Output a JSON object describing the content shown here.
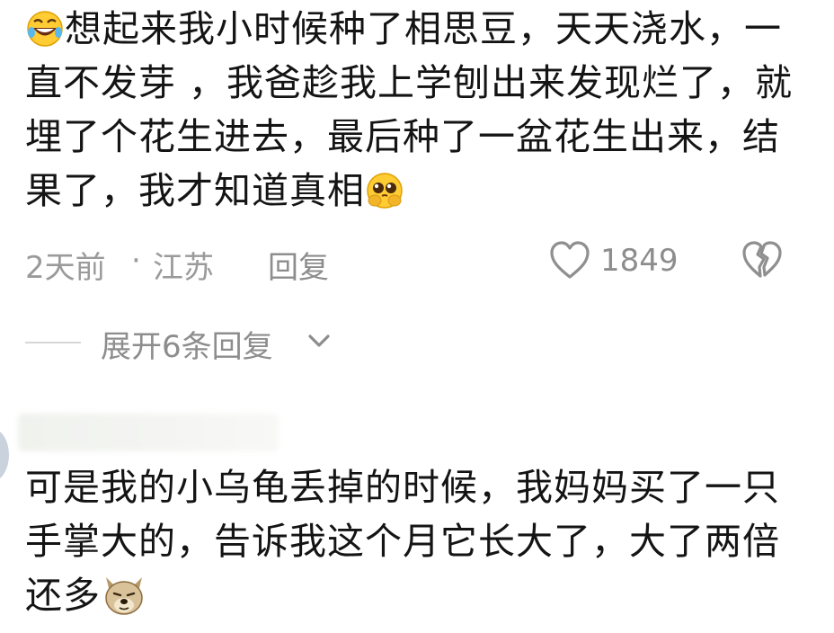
{
  "comment1": {
    "text_part1": "想起来我小时候种了相思豆，天天浇水，一直不发芽 ，我爸趁我上学刨出来发现烂了，就埋了个花生进去，最后种了一盆花生出来，结果了，我才知道真相",
    "leading_emoji": "rofl-laughing-emoji",
    "trailing_emoji": "pleading-face-emoji",
    "time": "2天前",
    "separator": "·",
    "location": "江苏",
    "reply_label": "回复",
    "like_count": "1849",
    "like_icon": "heart-outline-icon",
    "dislike_icon": "broken-heart-icon"
  },
  "expand_replies": {
    "label": "展开6条回复",
    "icon": "chevron-down-icon"
  },
  "comment2": {
    "text": "可是我的小乌龟丢掉的时候，我妈妈买了一只手掌大的，告诉我这个月它长大了，大了两倍还多",
    "trailing_emoji": "dog-face-sticker-emoji"
  },
  "colors": {
    "text_primary": "#141414",
    "text_secondary": "#8d8d8d",
    "background": "#ffffff"
  }
}
